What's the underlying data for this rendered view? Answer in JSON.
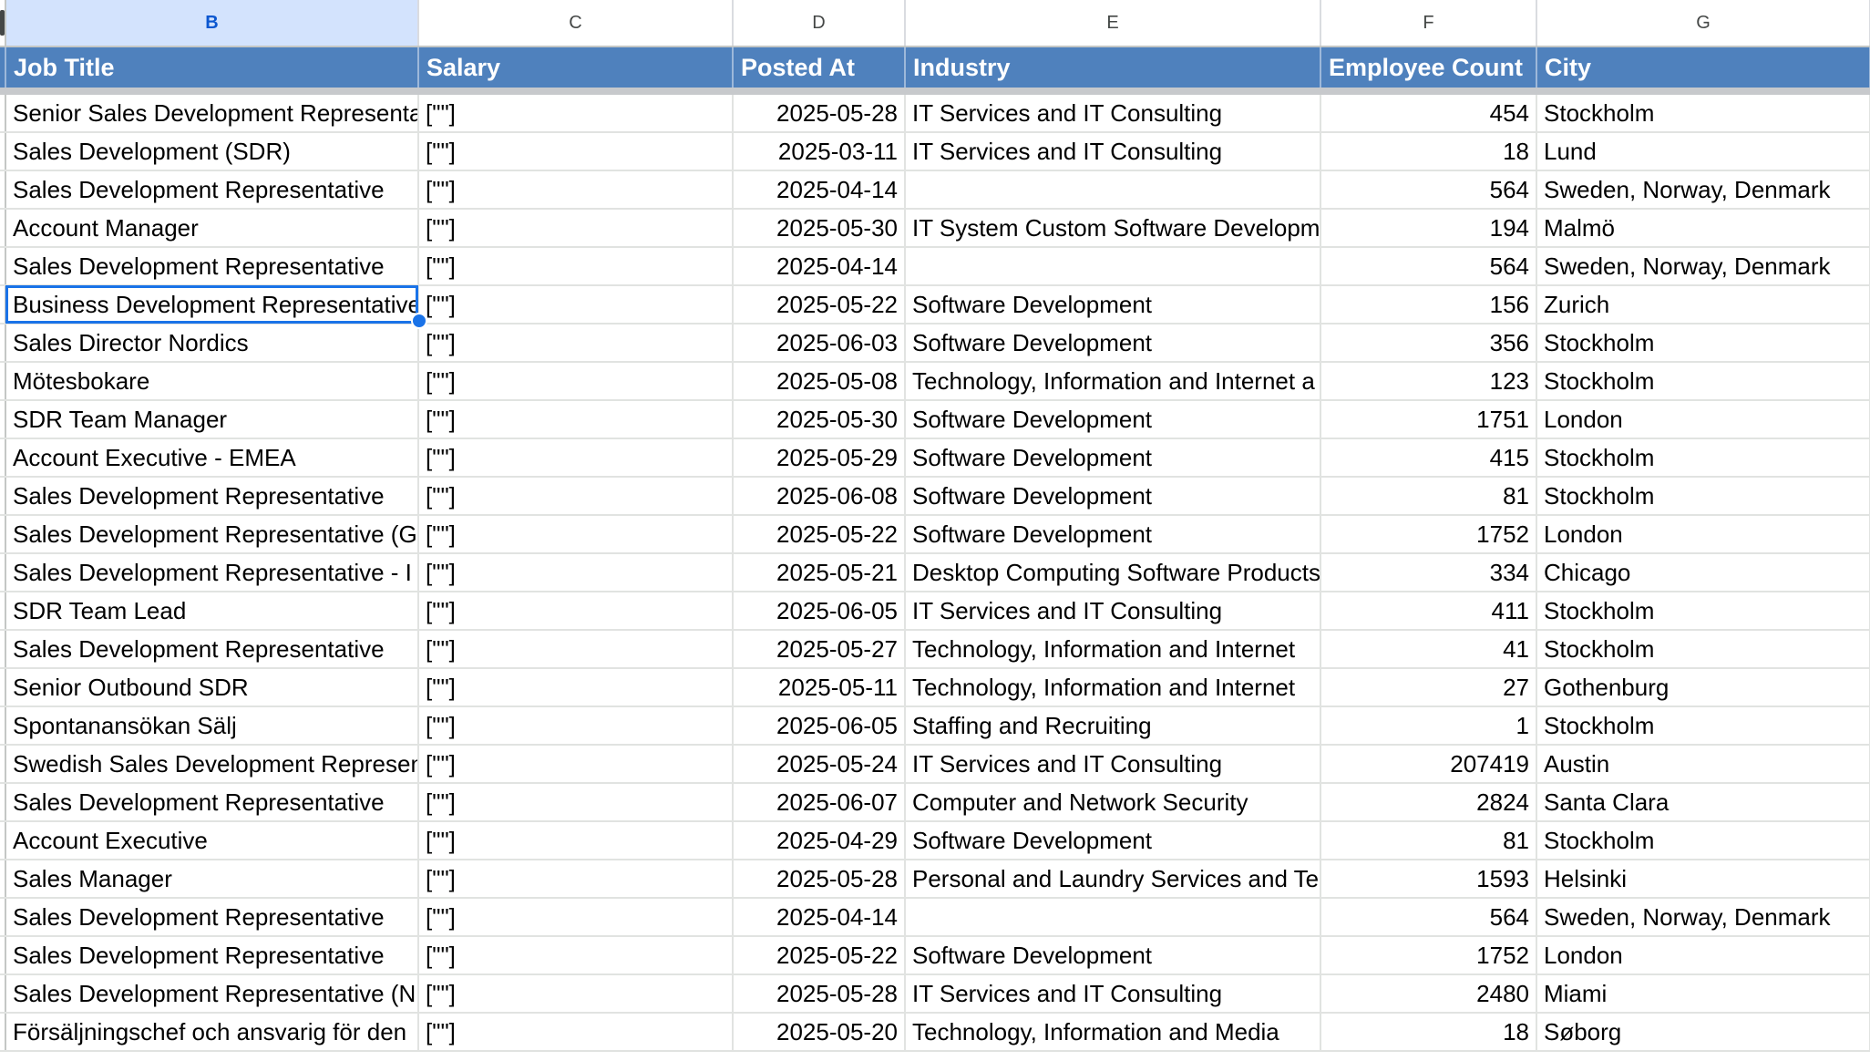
{
  "columns": [
    "B",
    "C",
    "D",
    "E",
    "F",
    "G"
  ],
  "headers": [
    "Job Title",
    "Salary",
    "Posted At",
    "Industry",
    "Employee Count",
    "City"
  ],
  "rows": [
    [
      "Senior Sales Development Representative",
      "[\"\"]",
      "2025-05-28",
      "IT Services and IT Consulting",
      "454",
      "Stockholm"
    ],
    [
      "Sales Development (SDR)",
      "[\"\"]",
      "2025-03-11",
      "IT Services and IT Consulting",
      "18",
      "Lund"
    ],
    [
      "Sales Development Representative",
      "[\"\"]",
      "2025-04-14",
      "",
      "564",
      "Sweden, Norway, Denmark"
    ],
    [
      "Account Manager",
      "[\"\"]",
      "2025-05-30",
      "IT System Custom Software Development",
      "194",
      "Malmö"
    ],
    [
      "Sales Development Representative",
      "[\"\"]",
      "2025-04-14",
      "",
      "564",
      "Sweden, Norway, Denmark"
    ],
    [
      "Business Development Representative",
      "[\"\"]",
      "2025-05-22",
      "Software Development",
      "156",
      "Zurich"
    ],
    [
      "Sales Director Nordics",
      "[\"\"]",
      "2025-06-03",
      "Software Development",
      "356",
      "Stockholm"
    ],
    [
      "Mötesbokare",
      "[\"\"]",
      "2025-05-08",
      "Technology, Information and Internet a",
      "123",
      "Stockholm"
    ],
    [
      "SDR Team Manager",
      "[\"\"]",
      "2025-05-30",
      "Software Development",
      "1751",
      "London"
    ],
    [
      "Account Executive - EMEA",
      "[\"\"]",
      "2025-05-29",
      "Software Development",
      "415",
      "Stockholm"
    ],
    [
      "Sales Development Representative",
      "[\"\"]",
      "2025-06-08",
      "Software Development",
      "81",
      "Stockholm"
    ],
    [
      "Sales Development Representative (G",
      "[\"\"]",
      "2025-05-22",
      "Software Development",
      "1752",
      "London"
    ],
    [
      "Sales Development Representative - I",
      "[\"\"]",
      "2025-05-21",
      "Desktop Computing Software Products",
      "334",
      "Chicago"
    ],
    [
      "SDR Team Lead",
      "[\"\"]",
      "2025-06-05",
      "IT Services and IT Consulting",
      "411",
      "Stockholm"
    ],
    [
      "Sales Development Representative",
      "[\"\"]",
      "2025-05-27",
      "Technology, Information and Internet",
      "41",
      "Stockholm"
    ],
    [
      "Senior Outbound SDR",
      "[\"\"]",
      "2025-05-11",
      "Technology, Information and Internet",
      "27",
      "Gothenburg"
    ],
    [
      "Spontanansökan Sälj",
      "[\"\"]",
      "2025-06-05",
      "Staffing and Recruiting",
      "1",
      "Stockholm"
    ],
    [
      "Swedish Sales Development Representative",
      "[\"\"]",
      "2025-05-24",
      "IT Services and IT Consulting",
      "207419",
      "Austin"
    ],
    [
      "Sales Development Representative",
      "[\"\"]",
      "2025-06-07",
      "Computer and Network Security",
      "2824",
      "Santa Clara"
    ],
    [
      "Account Executive",
      "[\"\"]",
      "2025-04-29",
      "Software Development",
      "81",
      "Stockholm"
    ],
    [
      "Sales Manager",
      "[\"\"]",
      "2025-05-28",
      "Personal and Laundry Services and Te",
      "1593",
      "Helsinki"
    ],
    [
      "Sales Development Representative",
      "[\"\"]",
      "2025-04-14",
      "",
      "564",
      "Sweden, Norway, Denmark"
    ],
    [
      "Sales Development Representative",
      "[\"\"]",
      "2025-05-22",
      "Software Development",
      "1752",
      "London"
    ],
    [
      "Sales Development Representative (N",
      "[\"\"]",
      "2025-05-28",
      "IT Services and IT Consulting",
      "2480",
      "Miami"
    ],
    [
      "Försäljningschef och ansvarig för den",
      "[\"\"]",
      "2025-05-20",
      "Technology, Information and Media",
      "18",
      "Søborg"
    ]
  ],
  "selected_column": "B",
  "active_row_index": 5
}
